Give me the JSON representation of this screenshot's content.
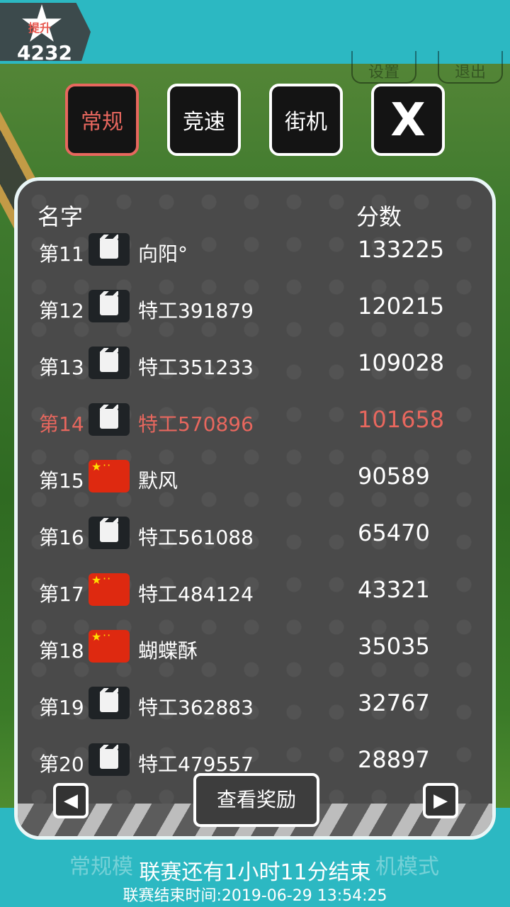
{
  "top": {
    "badge_label": "提升",
    "score": "4232",
    "settings_label": "设置",
    "exit_label": "退出"
  },
  "tabs": [
    {
      "label": "常规",
      "active": true
    },
    {
      "label": "竞速",
      "active": false
    },
    {
      "label": "街机",
      "active": false
    },
    {
      "label": "X",
      "active": false
    }
  ],
  "leaderboard": {
    "header_name": "名字",
    "header_score": "分数",
    "rows": [
      {
        "rank": "第11",
        "avatar": "cat-icon",
        "name": "向阳°",
        "score": "133225"
      },
      {
        "rank": "第12",
        "avatar": "cat-icon",
        "name": "特工391879",
        "score": "120215"
      },
      {
        "rank": "第13",
        "avatar": "cat-icon",
        "name": "特工351233",
        "score": "109028"
      },
      {
        "rank": "第14",
        "avatar": "cat-icon",
        "name": "特工570896",
        "score": "101658",
        "is_me": true
      },
      {
        "rank": "第15",
        "avatar": "china-flag-icon",
        "name": "默风",
        "score": "90589"
      },
      {
        "rank": "第16",
        "avatar": "cat-icon",
        "name": "特工561088",
        "score": "65470"
      },
      {
        "rank": "第17",
        "avatar": "china-flag-icon",
        "name": "特工484124",
        "score": "43321"
      },
      {
        "rank": "第18",
        "avatar": "china-flag-icon",
        "name": "蝴蝶酥",
        "score": "35035"
      },
      {
        "rank": "第19",
        "avatar": "cat-icon",
        "name": "特工362883",
        "score": "32767"
      },
      {
        "rank": "第20",
        "avatar": "cat-icon",
        "name": "特工479557",
        "score": "28897"
      }
    ],
    "prev_icon": "◀",
    "next_icon": "▶",
    "reward_label": "查看奖励"
  },
  "background_labels": {
    "mode1": "常规模",
    "mode3": "机模式"
  },
  "footer": {
    "countdown": "联赛还有1小时11分结束",
    "end_time": "联赛结束时间:2019-06-29 13:54:25"
  },
  "colors": {
    "accent": "#e8675e",
    "teal": "#2cb8c2",
    "panel": "#4a4a4a"
  }
}
